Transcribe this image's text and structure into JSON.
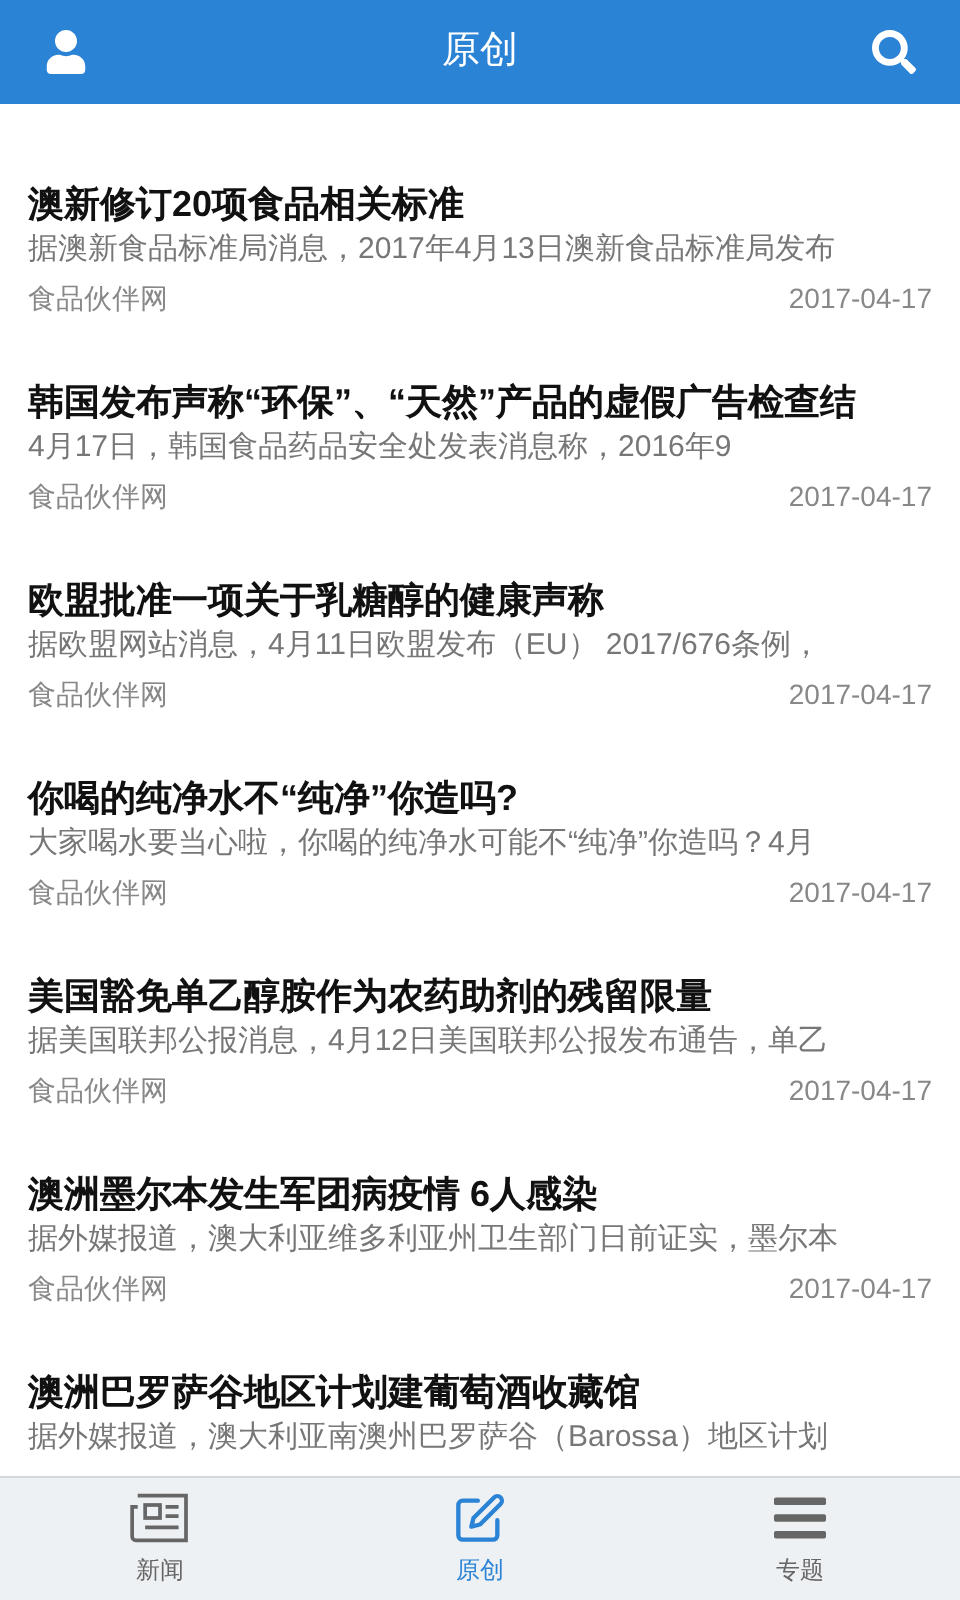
{
  "header": {
    "title": "原创"
  },
  "articles": [
    {
      "title": "澳新修订20项食品相关标准",
      "summary": "据澳新食品标准局消息，2017年4月13日澳新食品标准局发布",
      "source": "食品伙伴网",
      "date": "2017-04-17"
    },
    {
      "title": "韩国发布声称“环保”、“天然”产品的虚假广告检查结",
      "summary": "4月17日，韩国食品药品安全处发表消息称，2016年9",
      "source": "食品伙伴网",
      "date": "2017-04-17"
    },
    {
      "title": "欧盟批准一项关于乳糖醇的健康声称",
      "summary": "据欧盟网站消息，4月11日欧盟发布（EU） 2017/676条例，",
      "source": "食品伙伴网",
      "date": "2017-04-17"
    },
    {
      "title": "你喝的纯净水不“纯净”你造吗?",
      "summary": "大家喝水要当心啦，你喝的纯净水可能不“纯净”你造吗？4月",
      "source": "食品伙伴网",
      "date": "2017-04-17"
    },
    {
      "title": "美国豁免单乙醇胺作为农药助剂的残留限量",
      "summary": "据美国联邦公报消息，4月12日美国联邦公报发布通告，单乙",
      "source": "食品伙伴网",
      "date": "2017-04-17"
    },
    {
      "title": "澳洲墨尔本发生军团病疫情 6人感染",
      "summary": "据外媒报道，澳大利亚维多利亚州卫生部门日前证实，墨尔本",
      "source": "食品伙伴网",
      "date": "2017-04-17"
    },
    {
      "title": "澳洲巴罗萨谷地区计划建葡萄酒收藏馆",
      "summary": "据外媒报道，澳大利亚南澳州巴罗萨谷（Barossa）地区计划"
    }
  ],
  "tabs": [
    {
      "kind": "news",
      "label": "新闻",
      "selected": false
    },
    {
      "kind": "edit",
      "label": "原创",
      "selected": true
    },
    {
      "kind": "topics",
      "label": "专题",
      "selected": false
    }
  ]
}
